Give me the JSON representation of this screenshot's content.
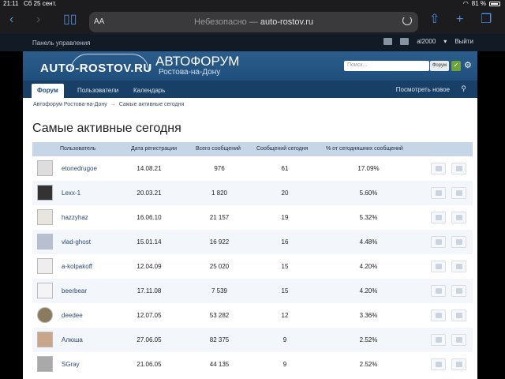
{
  "status": {
    "time": "21:11",
    "date": "Сб 25 сент.",
    "battery": "81 %"
  },
  "browser": {
    "aa": "AA",
    "insecure": "Небезопасно — ",
    "domain": "auto-rostov.ru"
  },
  "topbar": {
    "panel": "Панель управления",
    "user": "al2000",
    "logout": "Выйти"
  },
  "header": {
    "logo": "AUTO-ROSTOV.RU",
    "title": "АВТОФОРУМ",
    "subtitle": "Ростова-на-Дону",
    "search_placeholder": "Поиск...",
    "search_scope": "Форум"
  },
  "tabs": {
    "forum": "Форум",
    "users": "Пользователи",
    "calendar": "Календарь",
    "new": "Посмотреть новое"
  },
  "breadcrumb": {
    "home": "Автофорум Ростова-на-Дону",
    "current": "Самые активные сегодня"
  },
  "page_title": "Самые активные сегодня",
  "table": {
    "headers": [
      "Пользователь",
      "Дата регистрации",
      "Всего сообщений",
      "Сообщений сегодня",
      "% от сегодняшних сообщений"
    ],
    "rows": [
      {
        "user": "etonedrugoe",
        "reg": "14.08.21",
        "total": "976",
        "today": "61",
        "pct": "17.09%"
      },
      {
        "user": "Lexx-1",
        "reg": "20.03.21",
        "total": "1 820",
        "today": "20",
        "pct": "5.60%"
      },
      {
        "user": "hazzyhaz",
        "reg": "16.06.10",
        "total": "21 157",
        "today": "19",
        "pct": "5.32%"
      },
      {
        "user": "vlad-ghost",
        "reg": "15.01.14",
        "total": "16 922",
        "today": "16",
        "pct": "4.48%"
      },
      {
        "user": "a-kolpakoff",
        "reg": "12.04.09",
        "total": "25 020",
        "today": "15",
        "pct": "4.20%"
      },
      {
        "user": "beerbear",
        "reg": "17.11.08",
        "total": "7 539",
        "today": "15",
        "pct": "4.20%"
      },
      {
        "user": "deedee",
        "reg": "12.07.05",
        "total": "53 282",
        "today": "12",
        "pct": "3.36%"
      },
      {
        "user": "Алюша",
        "reg": "27.06.05",
        "total": "82 375",
        "today": "9",
        "pct": "2.52%"
      },
      {
        "user": "SGray",
        "reg": "21.06.05",
        "total": "44 135",
        "today": "9",
        "pct": "2.52%"
      }
    ]
  }
}
